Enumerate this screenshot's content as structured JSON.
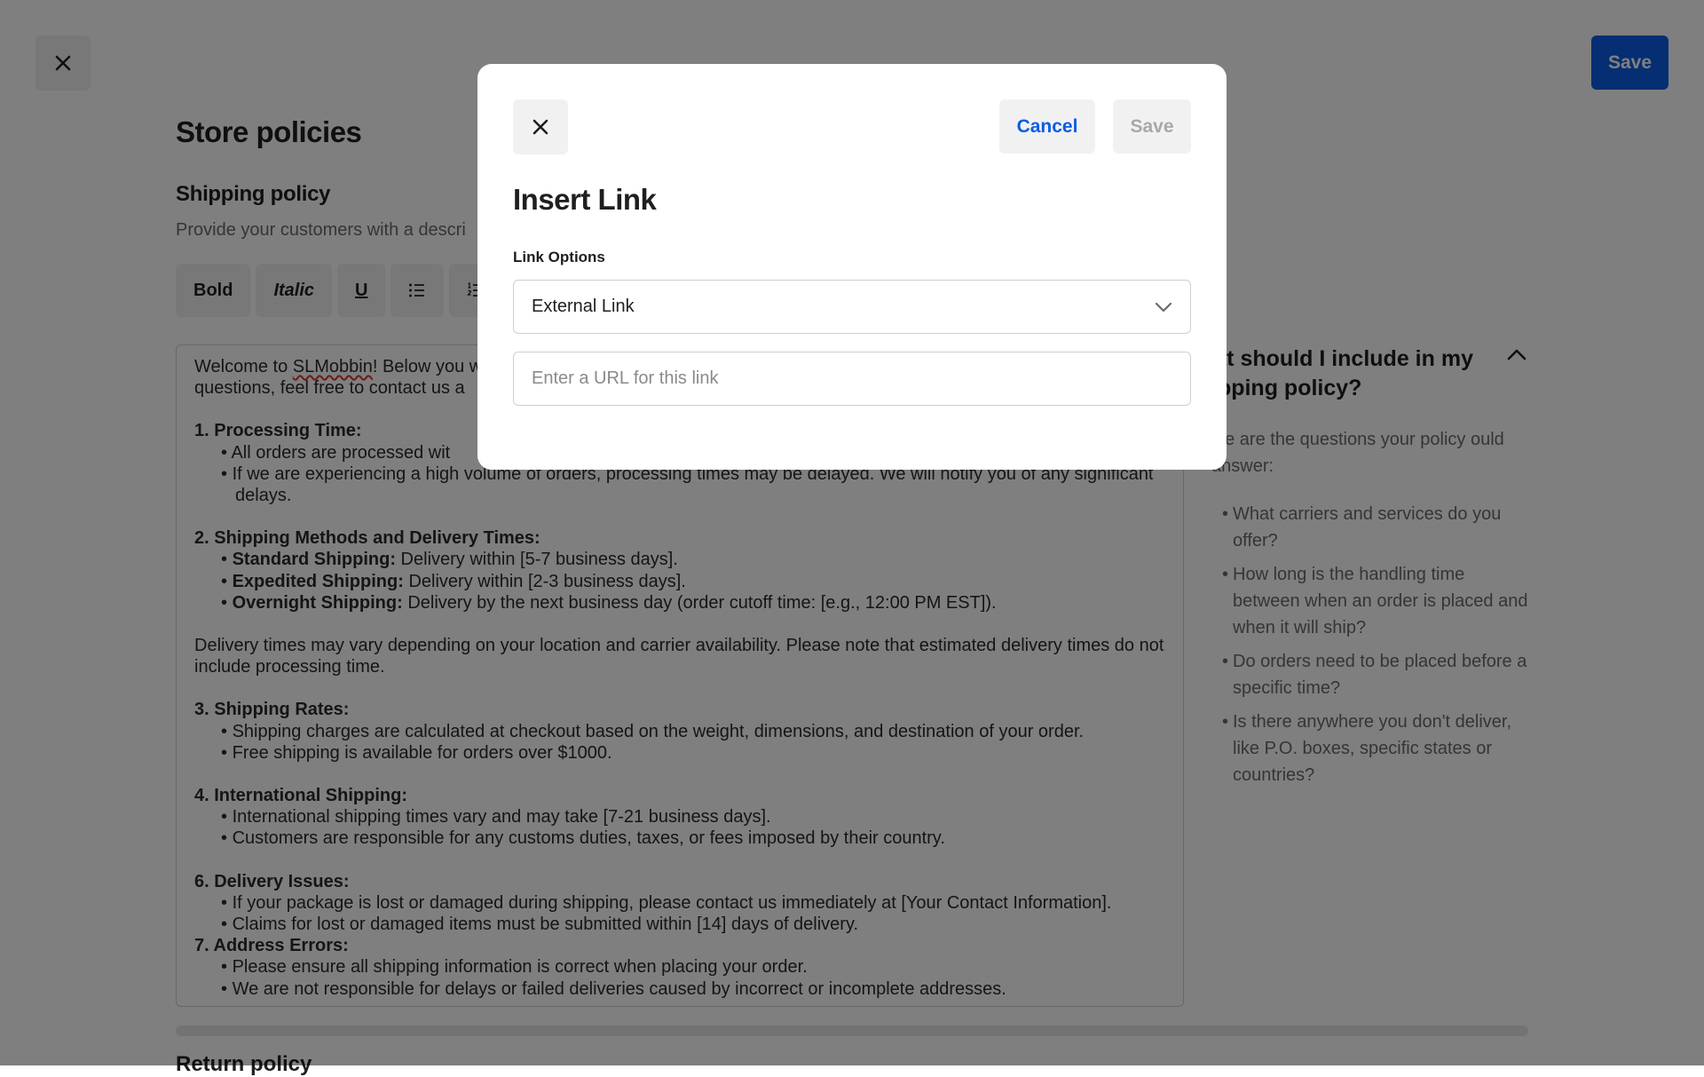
{
  "header": {
    "save_label": "Save"
  },
  "page": {
    "title": "Store policies",
    "section_title": "Shipping policy",
    "section_desc": "Provide your customers with a descri",
    "return_title": "Return policy"
  },
  "toolbar": {
    "bold_label": "Bold",
    "italic_label": "Italic",
    "underline_label": "U"
  },
  "editor": {
    "intro_1a": "Welcome to ",
    "intro_brand": "SLMobbin",
    "intro_1b": "! Below you w",
    "intro_2": "questions, feel free to contact us a",
    "s1_title": "1. Processing Time:",
    "s1_b1": "All orders are processed wit",
    "s1_b2": "If we are experiencing a high volume of orders, processing times may be delayed. We will notify you of any significant delays.",
    "s2_title": "2. Shipping Methods and Delivery Times:",
    "s2_b1_label": "Standard Shipping:",
    "s2_b1_text": " Delivery within [5-7 business days].",
    "s2_b2_label": "Expedited Shipping:",
    "s2_b2_text": " Delivery within [2-3 business days].",
    "s2_b3_label": "Overnight Shipping:",
    "s2_b3_text": " Delivery by the next business day (order cutoff time: [e.g., 12:00 PM EST]).",
    "delivery_note": "Delivery times may vary depending on your location and carrier availability. Please note that estimated delivery times do not include processing time.",
    "s3_title": "3. Shipping Rates:",
    "s3_b1": "Shipping charges are calculated at checkout based on the weight, dimensions, and destination of your order.",
    "s3_b2": "Free shipping is available for orders over $1000.",
    "s4_title": "4. International Shipping:",
    "s4_b1": "International shipping times vary and may take [7-21 business days].",
    "s4_b2": "Customers are responsible for any customs duties, taxes, or fees imposed by their country.",
    "s6_title": "6. Delivery Issues:",
    "s6_b1": "If your package is lost or damaged during shipping, please contact us immediately at [Your Contact Information].",
    "s6_b2": "Claims for lost or damaged items must be submitted within [14] days of delivery.",
    "s7_title": "7. Address Errors:",
    "s7_b1": "Please ensure all shipping information is correct when placing your order.",
    "s7_b2": "We are not responsible for delays or failed deliveries caused by incorrect or incomplete addresses."
  },
  "help": {
    "title": "hat should I include in my ipping policy?",
    "subtitle": "ese are the questions your policy ould answer:",
    "items": [
      "What carriers and services do you offer?",
      "How long is the handling time between when an order is placed and when it will ship?",
      "Do orders need to be placed before a specific time?",
      "Is there anywhere you don't deliver, like P.O. boxes, specific states or countries?"
    ]
  },
  "modal": {
    "cancel_label": "Cancel",
    "save_label": "Save",
    "title": "Insert Link",
    "link_options_label": "Link Options",
    "select_value": "External Link",
    "url_placeholder": "Enter a URL for this link"
  },
  "colors": {
    "accent": "#0a5ce6",
    "overlay": "rgba(0,0,0,0.5)"
  },
  "icons": {
    "close": "close-icon",
    "bullet_list": "bullet-list-icon",
    "numbered_list": "numbered-list-icon",
    "chevron_up": "chevron-up-icon",
    "chevron_down": "chevron-down-icon"
  }
}
